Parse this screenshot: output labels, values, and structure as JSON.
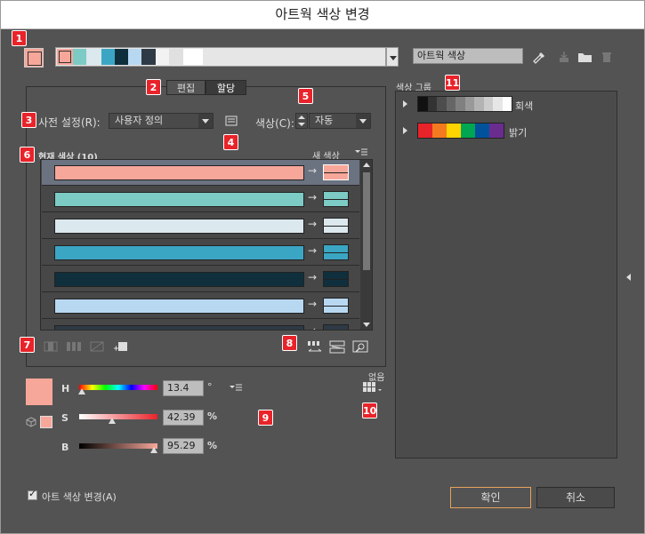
{
  "window": {
    "title": "아트웍 색상 변경"
  },
  "badges": [
    "1",
    "2",
    "3",
    "4",
    "5",
    "6",
    "7",
    "8",
    "9",
    "10",
    "11"
  ],
  "top": {
    "harmony_colors": [
      "#f7a79a",
      "#7ccbc4",
      "#dbe8ee",
      "#3ba6c4",
      "#0f2f3d",
      "#b8d8f2",
      "#2e3a45",
      "#f2f2f2",
      "#e0e0e0",
      "#ffffff"
    ],
    "name_value": "아트웍 색상"
  },
  "tabs": {
    "edit": "편집",
    "assign": "할당"
  },
  "preset": {
    "label": "사전 설정(R):",
    "value": "사용자 정의"
  },
  "colors_ctrl": {
    "label": "색상(C):",
    "value": "자동"
  },
  "list": {
    "current_header": "현재 색상 (10)",
    "new_header": "새 색상",
    "rows": [
      {
        "color": "#f7a79a"
      },
      {
        "color": "#7ccbc4"
      },
      {
        "color": "#dbe8ee"
      },
      {
        "color": "#3ba6c4"
      },
      {
        "color": "#0f2f3d"
      },
      {
        "color": "#b8d8f2"
      },
      {
        "color": "#2e3a45"
      }
    ]
  },
  "hsb": {
    "h_label": "H",
    "h_value": "13.4",
    "h_unit": "°",
    "s_label": "S",
    "s_value": "42.39",
    "s_unit": "%",
    "b_label": "B",
    "b_value": "95.29",
    "b_unit": "%",
    "h_fraction": 0.037,
    "s_fraction": 0.4239,
    "b_fraction": 0.9529
  },
  "none_label": "없음",
  "groups": {
    "title": "색상 그룹",
    "items": [
      {
        "name": "회색",
        "colors": [
          "#111",
          "#333",
          "#4d4d4d",
          "#666",
          "#808080",
          "#999",
          "#b3b3b3",
          "#ccc",
          "#e6e6e6",
          "#fff"
        ]
      },
      {
        "name": "밝기",
        "colors": [
          "#e8232a",
          "#f47a20",
          "#ffd400",
          "#00a651",
          "#00529b",
          "#6a2c8f"
        ]
      }
    ]
  },
  "footer": {
    "checkbox_label": "아트 색상 변경(A)",
    "ok": "확인",
    "cancel": "취소"
  }
}
